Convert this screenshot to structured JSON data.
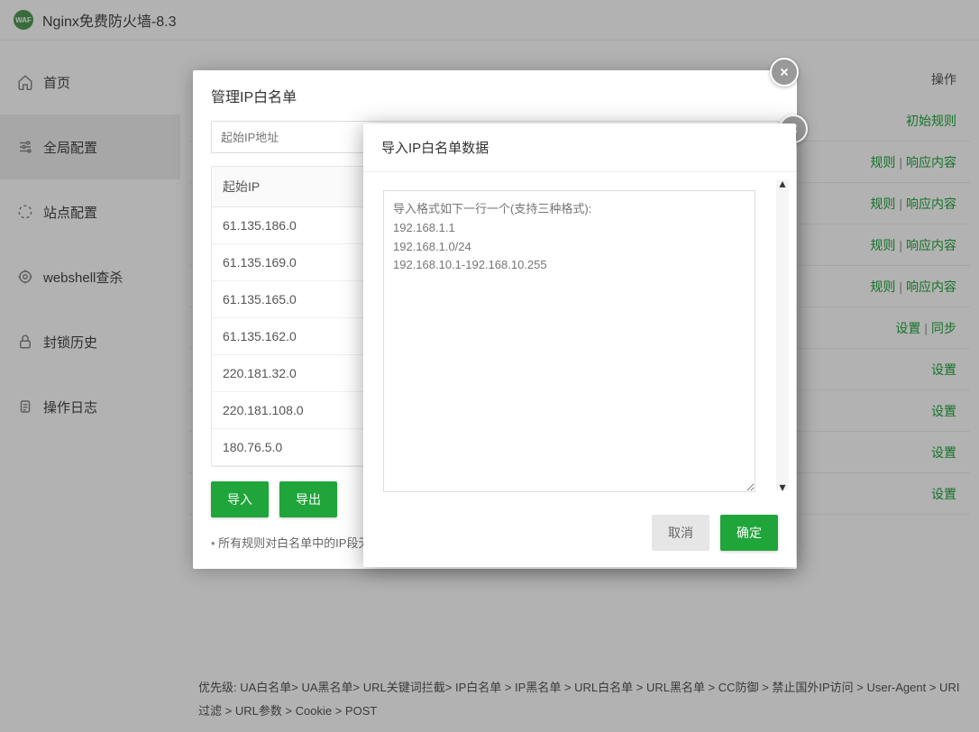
{
  "app": {
    "title": "Nginx免费防火墙-8.3",
    "badge": "WAF"
  },
  "sidebar": {
    "items": [
      {
        "label": "首页",
        "icon": "home"
      },
      {
        "label": "全局配置",
        "icon": "sliders"
      },
      {
        "label": "站点配置",
        "icon": "spinner"
      },
      {
        "label": "webshell查杀",
        "icon": "target"
      },
      {
        "label": "封锁历史",
        "icon": "lock"
      },
      {
        "label": "操作日志",
        "icon": "clipboard"
      }
    ]
  },
  "main": {
    "op_header": "操作",
    "rows": [
      {
        "links": [
          "初始规则"
        ]
      },
      {
        "links": [
          "规则",
          "响应内容"
        ]
      },
      {
        "links": [
          "规则",
          "响应内容"
        ]
      },
      {
        "links": [
          "规则",
          "响应内容"
        ]
      },
      {
        "links": [
          "规则",
          "响应内容"
        ]
      },
      {
        "links": [
          "设置",
          "同步"
        ]
      },
      {
        "links": [
          "设置"
        ]
      },
      {
        "links": [
          "设置"
        ]
      },
      {
        "links": [
          "设置"
        ]
      },
      {
        "links": [
          "设置"
        ]
      }
    ],
    "notes": [
      "优先级: UA白名单> UA黑名单> URL关键词拦截> IP白名单 > IP黑名单 > URL白名单 > URL黑名单 > CC防御 > 禁止国外IP访问 > User-Agent > URI过滤 > URL参数 > Cookie > POST"
    ]
  },
  "modal1": {
    "title": "管理IP白名单",
    "ip_placeholder": "起始IP地址",
    "th": "起始IP",
    "rows": [
      "61.135.186.0",
      "61.135.169.0",
      "61.135.165.0",
      "61.135.162.0",
      "220.181.32.0",
      "220.181.108.0",
      "180.76.5.0"
    ],
    "import_btn": "导入",
    "export_btn": "导出",
    "note": "所有规则对白名单中的IP段无效,包括IP黑名单和URL黑名单,IP白名单具备最高优先权"
  },
  "modal2": {
    "title": "导入IP白名单数据",
    "placeholder": "导入格式如下一行一个(支持三种格式):\n192.168.1.1\n192.168.1.0/24\n192.168.10.1-192.168.10.255",
    "cancel": "取消",
    "confirm": "确定"
  }
}
